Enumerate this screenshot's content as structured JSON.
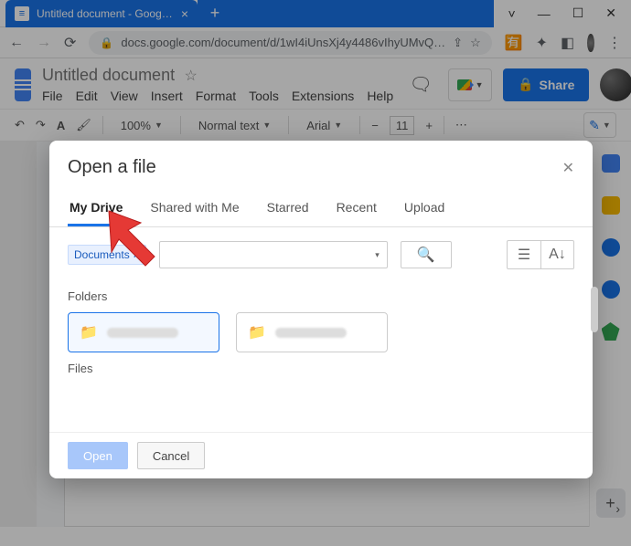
{
  "window": {
    "tab_title": "Untitled document - Google Docs",
    "new_tab": "+",
    "controls": {
      "min": "—",
      "max": "☐",
      "close": "✕",
      "chevron": "˅"
    }
  },
  "addressbar": {
    "url": "docs.google.com/document/d/1wI4iUnsXj4y4486vIhyUMvQ…"
  },
  "doc": {
    "title": "Untitled document",
    "menu": {
      "file": "File",
      "edit": "Edit",
      "view": "View",
      "insert": "Insert",
      "format": "Format",
      "tools": "Tools",
      "extensions": "Extensions",
      "help": "Help"
    },
    "share": "Share",
    "toolbar": {
      "zoom": "100%",
      "style": "Normal text",
      "font": "Arial",
      "size": "11"
    }
  },
  "picker": {
    "title": "Open a file",
    "tabs": {
      "mydrive": "My Drive",
      "shared": "Shared with Me",
      "starred": "Starred",
      "recent": "Recent",
      "upload": "Upload"
    },
    "chip": "Documents",
    "folders_label": "Folders",
    "files_label": "Files",
    "open": "Open",
    "cancel": "Cancel"
  }
}
